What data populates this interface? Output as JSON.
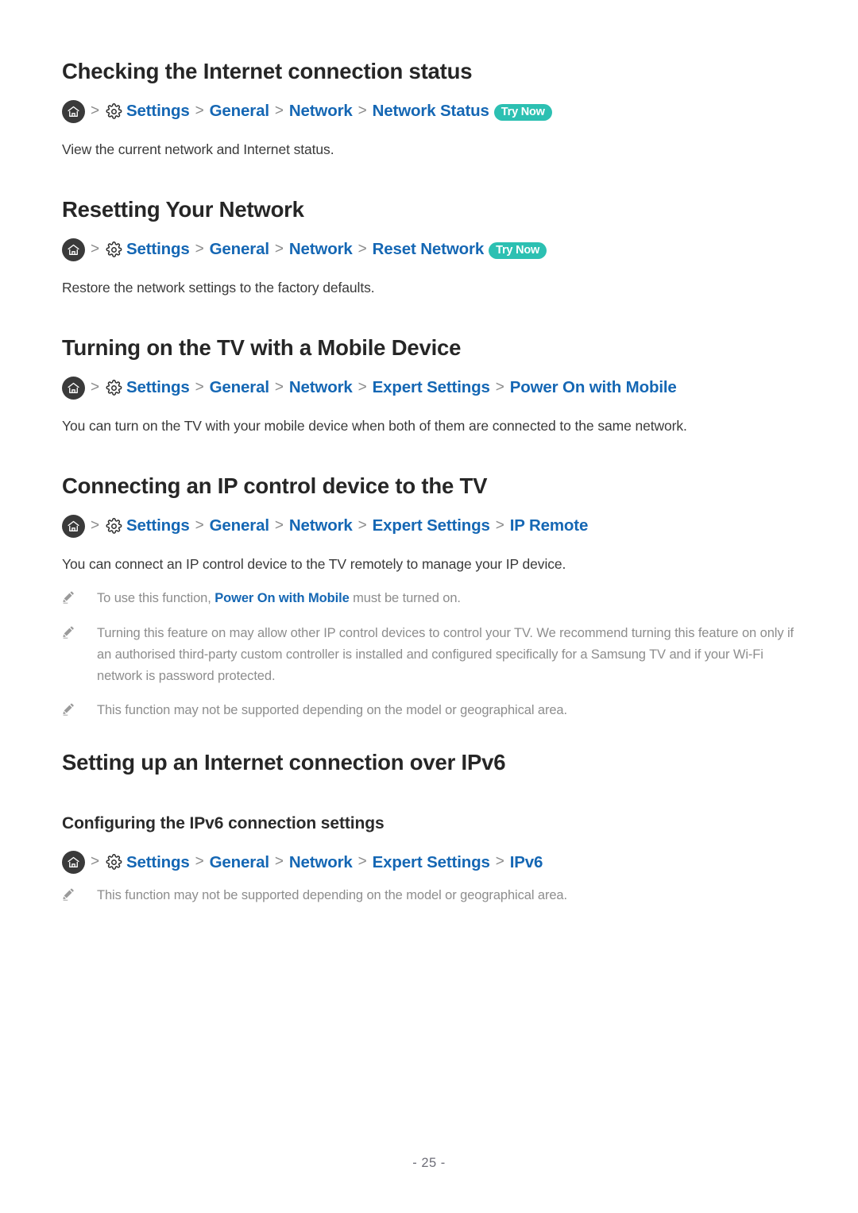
{
  "document": {
    "page_number": "- 25 -"
  },
  "icons": {
    "home": "home-icon",
    "gear": "gear-icon",
    "pencil": "pencil-icon",
    "chevron": "chevron-right-icon"
  },
  "colors": {
    "link_blue": "#1567B4",
    "badge_teal": "#2CC0B2",
    "heading": "#262626",
    "body": "#3A3A3A",
    "note": "#8D8D8D",
    "chevron": "#8A8A8A",
    "home_circle": "#3A3A3A"
  },
  "common": {
    "chevron": ">",
    "try_now": "Try Now",
    "crumb_settings": "Settings",
    "crumb_general": "General",
    "crumb_network": "Network",
    "crumb_expert_settings": "Expert Settings"
  },
  "sections": [
    {
      "id": "checking-internet-connection-status",
      "title": "Checking the Internet connection status",
      "path": {
        "crumbs": [
          "Settings",
          "General",
          "Network",
          "Network Status"
        ],
        "badge": "Try Now"
      },
      "body": "View the current network and Internet status."
    },
    {
      "id": "resetting-your-network",
      "title": "Resetting Your Network",
      "path": {
        "crumbs": [
          "Settings",
          "General",
          "Network",
          "Reset Network"
        ],
        "badge": "Try Now"
      },
      "body": "Restore the network settings to the factory defaults."
    },
    {
      "id": "turning-on-tv-with-mobile-device",
      "title": "Turning on the TV with a Mobile Device",
      "path": {
        "crumbs": [
          "Settings",
          "General",
          "Network",
          "Expert Settings",
          "Power On with Mobile"
        ],
        "badge": ""
      },
      "body": "You can turn on the TV with your mobile device when both of them are connected to the same network."
    },
    {
      "id": "connecting-ip-control-device",
      "title": "Connecting an IP control device to the TV",
      "path": {
        "crumbs": [
          "Settings",
          "General",
          "Network",
          "Expert Settings",
          "IP Remote"
        ],
        "badge": ""
      },
      "body": "You can connect an IP control device to the TV remotely to manage your IP device.",
      "notes": [
        {
          "lead": "To use this function, ",
          "link": "Power On with Mobile",
          "tail": " must be turned on."
        },
        {
          "lead": "Turning this feature on may allow other IP control devices to control your TV. We recommend turning this feature on only if an authorised third-party custom controller is installed and configured specifically for a Samsung TV and if your Wi-Fi network is password protected.",
          "link": "",
          "tail": ""
        },
        {
          "lead": "This function may not be supported depending on the model or geographical area.",
          "link": "",
          "tail": ""
        }
      ]
    },
    {
      "id": "setting-up-internet-over-ipv6",
      "title": "Setting up an Internet connection over IPv6",
      "subsection": {
        "title": "Configuring the IPv6 connection settings",
        "path": {
          "crumbs": [
            "Settings",
            "General",
            "Network",
            "Expert Settings",
            "IPv6"
          ],
          "badge": ""
        },
        "notes": [
          {
            "lead": "This function may not be supported depending on the model or geographical area.",
            "link": "",
            "tail": ""
          }
        ]
      }
    }
  ]
}
